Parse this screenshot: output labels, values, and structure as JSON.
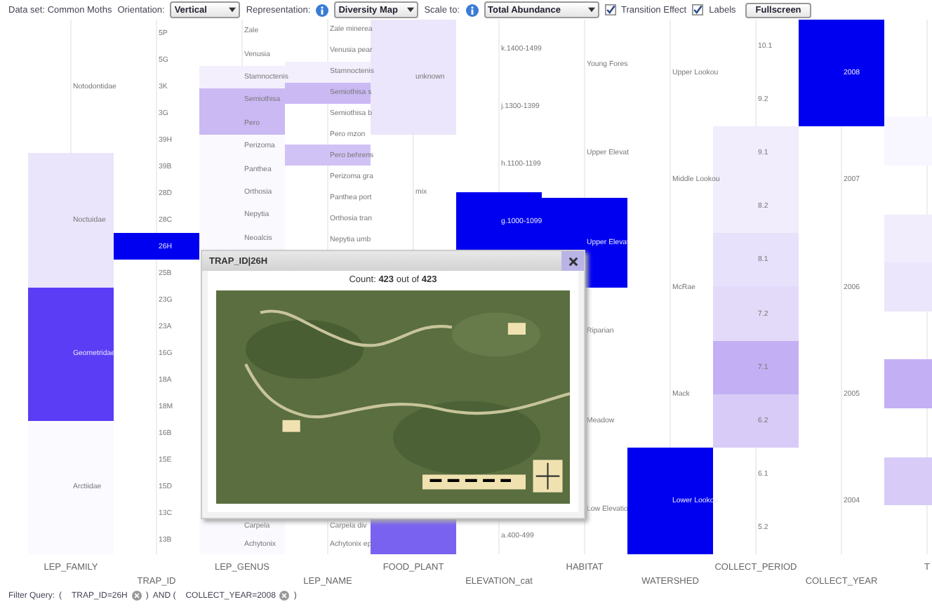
{
  "toolbar": {
    "dataset": "Data set: Common Moths",
    "orientation_label": "Orientation:",
    "orientation": "Vertical",
    "representation_label": "Representation:",
    "representation": "Diversity Map",
    "scale_label": "Scale to:",
    "scale": "Total Abundance",
    "checkboxes": [
      {
        "label": "Transition Effect",
        "checked": true
      },
      {
        "label": "Labels",
        "checked": true
      }
    ],
    "fullscreen": "Fullscreen"
  },
  "columns": [
    {
      "title": "LEP_FAMILY",
      "items": [
        {
          "label": "Notodontidae"
        },
        {
          "label": "Noctuidae",
          "color": "#ebe5fb"
        },
        {
          "label": "Geometridae",
          "color": "#5a3df5"
        },
        {
          "label": "Arctiidae",
          "color": "#fbfaff"
        }
      ]
    },
    {
      "title": "TRAP_ID",
      "items": [
        {
          "label": "5P"
        },
        {
          "label": "5G"
        },
        {
          "label": "3K"
        },
        {
          "label": "3G"
        },
        {
          "label": "39H"
        },
        {
          "label": "39B"
        },
        {
          "label": "28D"
        },
        {
          "label": "28C"
        },
        {
          "label": "26H",
          "color": "#0000f0"
        },
        {
          "label": "25B"
        },
        {
          "label": "23G"
        },
        {
          "label": "23A"
        },
        {
          "label": "16G"
        },
        {
          "label": "18A"
        },
        {
          "label": "18M"
        },
        {
          "label": "16B"
        },
        {
          "label": "15E"
        },
        {
          "label": "15D"
        },
        {
          "label": "13C"
        },
        {
          "label": "13B"
        }
      ]
    },
    {
      "title": "LEP_GENUS",
      "items": [
        {
          "label": "Zale"
        },
        {
          "label": "Venusia"
        },
        {
          "label": "Stamnoctenis",
          "color": "#f3effd"
        },
        {
          "label": "Semiothisa",
          "color": "#cbb9f4"
        },
        {
          "label": "Pero",
          "color": "#cbb9f4"
        },
        {
          "label": "Perizoma",
          "color": "#faf9fe"
        },
        {
          "label": "Panthea",
          "color": "#faf9fe"
        },
        {
          "label": "Orthosia",
          "color": "#faf9fe"
        },
        {
          "label": "Nepytia",
          "color": "#faf9fe"
        },
        {
          "label": "Neoalcis",
          "color": "#faf9fe"
        }
      ],
      "lower_items": [
        {
          "label": "Carpela",
          "color": "#faf9fe"
        },
        {
          "label": "Achytonix",
          "color": "#faf9fe"
        }
      ]
    },
    {
      "title": "LEP_NAME",
      "items": [
        {
          "label": "Zale minerea"
        },
        {
          "label": "Venusia pear"
        },
        {
          "label": "Stamnoctenis",
          "color": "#f3effd"
        },
        {
          "label": "Semiothisa s",
          "color": "#cbb9f4"
        },
        {
          "label": "Semiothisa b"
        },
        {
          "label": "Pero mzon"
        },
        {
          "label": "Pero behrens",
          "color": "#d1c2f6"
        },
        {
          "label": "Perizoma gra"
        },
        {
          "label": "Panthea port"
        },
        {
          "label": "Orthosia tran"
        },
        {
          "label": "Nepytia umb"
        }
      ],
      "lower_items": [
        {
          "label": "Carpela div"
        },
        {
          "label": "Achytonix ep"
        }
      ]
    },
    {
      "title": "FOOD_PLANT",
      "items": [
        {
          "label": "unknown",
          "color": "#ece6fc"
        },
        {
          "label": "mix"
        }
      ],
      "lower_items": [
        {
          "color": "#7a62f0"
        }
      ]
    },
    {
      "title": "ELEVATION_cat",
      "items": [
        {
          "label": "k.1400-1499"
        },
        {
          "label": "j.1300-1399"
        },
        {
          "label": "h.1100-1199"
        },
        {
          "label": "g.1000-1099",
          "color": "#0000f0"
        }
      ],
      "lower_items": [
        {
          "label": "a.400-499"
        }
      ]
    },
    {
      "title": "HABITAT",
      "items": [
        {
          "label": "Young Fores"
        },
        {
          "label": "Upper Elevat"
        },
        {
          "label": "Upper Elevat",
          "color": "#0000f0"
        },
        {
          "label": "Riparian"
        },
        {
          "label": "Meadow"
        },
        {
          "label": "Low Elevatio"
        }
      ]
    },
    {
      "title": "WATERSHED",
      "items": [
        {
          "label": "Upper Lookou"
        },
        {
          "label": "Middle Lookou"
        },
        {
          "label": "McRae"
        },
        {
          "label": "Mack"
        },
        {
          "label": "Lower Lookou",
          "color": "#0000f0"
        }
      ]
    },
    {
      "title": "COLLECT_PERIOD",
      "items": [
        {
          "label": "10.1"
        },
        {
          "label": "9.2"
        },
        {
          "label": "9.1",
          "color": "#f1edfc"
        },
        {
          "label": "8.2",
          "color": "#f1edfc"
        },
        {
          "label": "8.1",
          "color": "#e8e1fb"
        },
        {
          "label": "7.2",
          "color": "#e3dafa"
        },
        {
          "label": "7.1",
          "color": "#c3aff3"
        },
        {
          "label": "6.2",
          "color": "#d8cbf7"
        },
        {
          "label": "6.1"
        },
        {
          "label": "5.2"
        }
      ]
    },
    {
      "title": "COLLECT_YEAR",
      "items": [
        {
          "label": "2008",
          "color": "#0000f0"
        },
        {
          "label": "2007"
        },
        {
          "label": "2006"
        },
        {
          "label": "2005"
        },
        {
          "label": "2004"
        }
      ]
    },
    {
      "title": "T",
      "items": [
        {
          "kind": "empty"
        },
        {
          "kind": "empty"
        },
        {
          "kind": "band",
          "color": "#f8f6fe"
        },
        {
          "kind": "empty"
        },
        {
          "kind": "band",
          "color": "#f1edfc"
        },
        {
          "kind": "band",
          "color": "#ece6fc"
        },
        {
          "kind": "empty"
        },
        {
          "kind": "band",
          "color": "#c3aff3"
        },
        {
          "kind": "empty"
        },
        {
          "kind": "band",
          "color": "#d8cbf7"
        },
        {
          "kind": "empty"
        }
      ]
    }
  ],
  "popup": {
    "title": "TRAP_ID|26H",
    "count": "Count: **423** out of **423**"
  },
  "filter": {
    "label": "Filter Query:",
    "terms": [
      {
        "prefix": "(",
        "text": "TRAP_ID=26H",
        "suffix": ")"
      },
      {
        "prefix": "AND (",
        "text": "COLLECT_YEAR=2008",
        "suffix": ")"
      }
    ]
  }
}
